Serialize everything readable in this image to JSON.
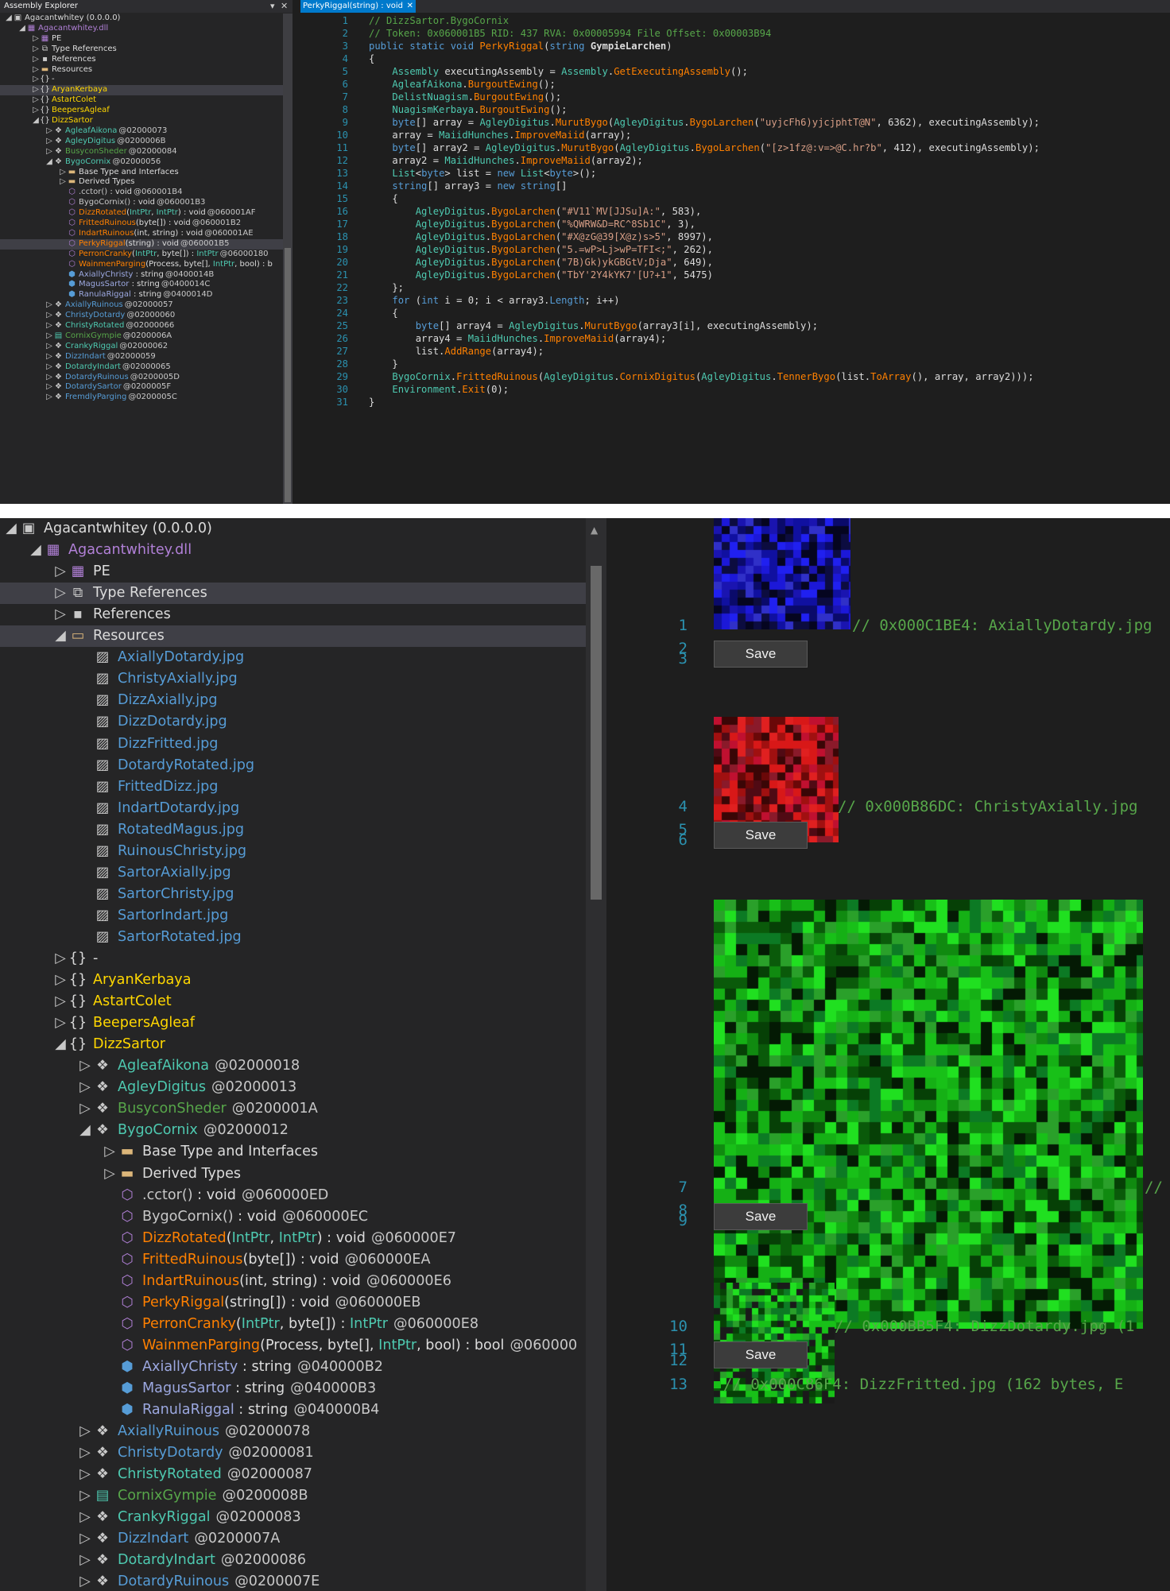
{
  "top": {
    "explorer": {
      "title": "Assembly Explorer",
      "items": [
        {
          "label": "Agacantwhitey (0.0.0.0)",
          "expand": "◢",
          "icon": "assembly-icon"
        },
        {
          "label": "Agacantwhitey.dll",
          "expand": "◢",
          "icon": "module-icon"
        },
        {
          "label": "PE",
          "expand": "▷",
          "icon": "pe-icon"
        },
        {
          "label": "Type References",
          "expand": "▷",
          "icon": "type-references-icon"
        },
        {
          "label": "References",
          "expand": "▷",
          "icon": "references-icon"
        },
        {
          "label": "Resources",
          "expand": "▷",
          "icon": "folder-icon"
        },
        {
          "label": "-",
          "expand": "▷",
          "icon": "namespace-icon"
        },
        {
          "label": "AryanKerbaya",
          "expand": "▷",
          "icon": "namespace-icon"
        },
        {
          "label": "AstartColet",
          "expand": "▷",
          "icon": "namespace-icon"
        },
        {
          "label": "BeepersAgleaf",
          "expand": "▷",
          "icon": "namespace-icon"
        },
        {
          "label": "DizzSartor",
          "expand": "◢",
          "icon": "namespace-icon"
        },
        {
          "label": "AgleafAikona",
          "token": "@02000073",
          "expand": "▷",
          "icon": "class-icon"
        },
        {
          "label": "AgleyDigitus",
          "token": "@0200006B",
          "expand": "▷",
          "icon": "class-icon"
        },
        {
          "label": "BusyconSheder",
          "token": "@02000084",
          "expand": "▷",
          "icon": "class-icon"
        },
        {
          "label": "BygoCornix",
          "token": "@02000056",
          "expand": "◢",
          "icon": "class-icon"
        },
        {
          "label": "Base Type and Interfaces",
          "expand": "▷",
          "icon": "folder-icon"
        },
        {
          "label": "Derived Types",
          "expand": "▷",
          "icon": "folder-icon"
        },
        {
          "label": ".cctor()",
          "sig": " : void",
          "token": "@060001B4",
          "icon": "method-icon"
        },
        {
          "label": "BygoCornix()",
          "sig": " : void",
          "token": "@060001B3",
          "icon": "method-icon"
        },
        {
          "label": "DizzRotated",
          "p1": "(",
          "a1": "IntPtr",
          "p2": ", ",
          "a2": "IntPtr",
          "p3": ") : void",
          "token": "@060001AF",
          "icon": "method-icon"
        },
        {
          "label": "FrittedRuinous",
          "p1": "(byte[]) : void",
          "token": "@060001B2",
          "icon": "method-icon"
        },
        {
          "label": "IndartRuinous",
          "p1": "(int, string) : void",
          "token": "@060001AE",
          "icon": "method-icon"
        },
        {
          "label": "PerkyRiggal",
          "p1": "(string) : void",
          "token": "@060001B5",
          "icon": "method-icon"
        },
        {
          "label": "PerronCranky",
          "p1": "(",
          "a1": "IntPtr",
          "p2": ", byte[]) : ",
          "a2": "IntPtr",
          "token": "@06000180",
          "icon": "method-icon"
        },
        {
          "label": "WainmenParging",
          "p1": "(Process, byte[], ",
          "a1": "IntPtr",
          "p2": ", bool) : b",
          "icon": "method-icon"
        },
        {
          "label": "AxiallyChristy",
          "sig": " : string",
          "token": "@0400014B",
          "icon": "field-icon"
        },
        {
          "label": "MagusSartor",
          "sig": " : string",
          "token": "@0400014C",
          "icon": "field-icon"
        },
        {
          "label": "RanulaRiggal",
          "sig": " : string",
          "token": "@0400014D",
          "icon": "field-icon"
        },
        {
          "label": "AxiallyRuinous",
          "token": "@02000057",
          "expand": "▷",
          "icon": "class-icon"
        },
        {
          "label": "ChristyDotardy",
          "token": "@02000060",
          "expand": "▷",
          "icon": "class-icon"
        },
        {
          "label": "ChristyRotated",
          "token": "@02000066",
          "expand": "▷",
          "icon": "class-icon"
        },
        {
          "label": "CornixGympie",
          "token": "@0200006A",
          "expand": "▷",
          "icon": "struct-icon"
        },
        {
          "label": "CrankyRiggal",
          "token": "@02000062",
          "expand": "▷",
          "icon": "class-icon"
        },
        {
          "label": "DizzIndart",
          "token": "@02000059",
          "expand": "▷",
          "icon": "class-icon"
        },
        {
          "label": "DotardyIndart",
          "token": "@02000065",
          "expand": "▷",
          "icon": "class-icon"
        },
        {
          "label": "DotardyRuinous",
          "token": "@0200005D",
          "expand": "▷",
          "icon": "class-icon"
        },
        {
          "label": "DotardySartor",
          "token": "@0200005F",
          "expand": "▷",
          "icon": "class-icon"
        },
        {
          "label": "FremdlyParging",
          "token": "@0200005C",
          "expand": "▷",
          "icon": "class-icon"
        }
      ]
    },
    "tab_label": "PerkyRiggal(string) : void",
    "code_line_numbers": [
      "1",
      "2",
      "3",
      "4",
      "5",
      "6",
      "7",
      "8",
      "9",
      "10",
      "11",
      "12",
      "13",
      "14",
      "15",
      "16",
      "17",
      "18",
      "19",
      "20",
      "21",
      "22",
      "23",
      "24",
      "25",
      "26",
      "27",
      "28",
      "29",
      "30",
      "31"
    ]
  },
  "bottom": {
    "tree": {
      "items": [
        {
          "label": "Agacantwhitey (0.0.0.0)",
          "expand": "◢",
          "icon": "assembly-icon"
        },
        {
          "label": "Agacantwhitey.dll",
          "expand": "◢",
          "icon": "module-icon"
        },
        {
          "label": "PE",
          "expand": "▷",
          "icon": "pe-icon"
        },
        {
          "label": "Type References",
          "expand": "▷",
          "icon": "type-references-icon"
        },
        {
          "label": "References",
          "expand": "▷",
          "icon": "references-icon"
        },
        {
          "label": "Resources",
          "expand": "◢",
          "icon": "folder-open-icon"
        },
        {
          "label": "AxiallyDotardy.jpg",
          "icon": "image-file-icon"
        },
        {
          "label": "ChristyAxially.jpg",
          "icon": "image-file-icon"
        },
        {
          "label": "DizzAxially.jpg",
          "icon": "image-file-icon"
        },
        {
          "label": "DizzDotardy.jpg",
          "icon": "image-file-icon"
        },
        {
          "label": "DizzFritted.jpg",
          "icon": "image-file-icon"
        },
        {
          "label": "DotardyRotated.jpg",
          "icon": "image-file-icon"
        },
        {
          "label": "FrittedDizz.jpg",
          "icon": "image-file-icon"
        },
        {
          "label": "IndartDotardy.jpg",
          "icon": "image-file-icon"
        },
        {
          "label": "RotatedMagus.jpg",
          "icon": "image-file-icon"
        },
        {
          "label": "RuinousChristy.jpg",
          "icon": "image-file-icon"
        },
        {
          "label": "SartorAxially.jpg",
          "icon": "image-file-icon"
        },
        {
          "label": "SartorChristy.jpg",
          "icon": "image-file-icon"
        },
        {
          "label": "SartorIndart.jpg",
          "icon": "image-file-icon"
        },
        {
          "label": "SartorRotated.jpg",
          "icon": "image-file-icon"
        },
        {
          "label": "-",
          "expand": "▷",
          "icon": "namespace-icon"
        },
        {
          "label": "AryanKerbaya",
          "expand": "▷",
          "icon": "namespace-icon"
        },
        {
          "label": "AstartColet",
          "expand": "▷",
          "icon": "namespace-icon"
        },
        {
          "label": "BeepersAgleaf",
          "expand": "▷",
          "icon": "namespace-icon"
        },
        {
          "label": "DizzSartor",
          "expand": "◢",
          "icon": "namespace-icon"
        },
        {
          "label": "AgleafAikona",
          "token": "@02000018",
          "expand": "▷",
          "icon": "class-icon"
        },
        {
          "label": "AgleyDigitus",
          "token": "@02000013",
          "expand": "▷",
          "icon": "class-icon"
        },
        {
          "label": "BusyconSheder",
          "token": "@0200001A",
          "expand": "▷",
          "icon": "class-icon"
        },
        {
          "label": "BygoCornix",
          "token": "@02000012",
          "expand": "◢",
          "icon": "class-icon"
        },
        {
          "label": "Base Type and Interfaces",
          "expand": "▷",
          "icon": "folder-icon"
        },
        {
          "label": "Derived Types",
          "expand": "▷",
          "icon": "folder-icon"
        },
        {
          "label": ".cctor()",
          "sig": " : void",
          "token": "@060000ED",
          "icon": "method-icon"
        },
        {
          "label": "BygoCornix()",
          "sig": " : void",
          "token": "@060000EC",
          "icon": "method-icon"
        },
        {
          "label": "DizzRotated",
          "p1": "(",
          "a1": "IntPtr",
          "p2": ", ",
          "a2": "IntPtr",
          "p3": ") : void",
          "token": "@060000E7",
          "icon": "method-icon"
        },
        {
          "label": "FrittedRuinous",
          "p1": "(byte[]) : void",
          "token": "@060000EA",
          "icon": "method-icon"
        },
        {
          "label": "IndartRuinous",
          "p1": "(int, string) : void",
          "token": "@060000E6",
          "icon": "method-icon"
        },
        {
          "label": "PerkyRiggal",
          "p1": "(string[]) : void",
          "token": "@060000EB",
          "icon": "method-icon"
        },
        {
          "label": "PerronCranky",
          "p1": "(",
          "a1": "IntPtr",
          "p2": ", byte[]) : ",
          "a2": "IntPtr",
          "token": "@060000E8",
          "icon": "method-icon"
        },
        {
          "label": "WainmenParging",
          "p1": "(Process, byte[], ",
          "a1": "IntPtr",
          "p2": ", bool) : bool",
          "token": "@060000",
          "icon": "method-icon"
        },
        {
          "label": "AxiallyChristy",
          "sig": " : string",
          "token": "@040000B2",
          "icon": "field-icon"
        },
        {
          "label": "MagusSartor",
          "sig": " : string",
          "token": "@040000B3",
          "icon": "field-icon"
        },
        {
          "label": "RanulaRiggal",
          "sig": " : string",
          "token": "@040000B4",
          "icon": "field-icon"
        },
        {
          "label": "AxiallyRuinous",
          "token": "@02000078",
          "expand": "▷",
          "icon": "class-icon"
        },
        {
          "label": "ChristyDotardy",
          "token": "@02000081",
          "expand": "▷",
          "icon": "class-icon"
        },
        {
          "label": "ChristyRotated",
          "token": "@02000087",
          "expand": "▷",
          "icon": "class-icon"
        },
        {
          "label": "CornixGympie",
          "token": "@0200008B",
          "expand": "▷",
          "icon": "struct-icon"
        },
        {
          "label": "CrankyRiggal",
          "token": "@02000083",
          "expand": "▷",
          "icon": "class-icon"
        },
        {
          "label": "DizzIndart",
          "token": "@0200007A",
          "expand": "▷",
          "icon": "class-icon"
        },
        {
          "label": "DotardyIndart",
          "token": "@02000086",
          "expand": "▷",
          "icon": "class-icon"
        },
        {
          "label": "DotardyRuinous",
          "token": "@0200007E",
          "expand": "▷",
          "icon": "class-icon"
        }
      ]
    },
    "resource_view": {
      "line_numbers": [
        "1",
        "2",
        "3",
        "4",
        "5",
        "6",
        "7",
        "8",
        "9",
        "10",
        "11",
        "12",
        "13"
      ],
      "save_label": "Save",
      "comments": [
        "// 0x000C1BE4: AxiallyDotardy.jpg",
        "// 0x000B86DC: ChristyAxially.jpg",
        "//",
        "// 0x000BB5F4: DizzDotardy.jpg (1",
        "// 0x000C86F4: DizzFritted.jpg (162 bytes, E"
      ],
      "image_names": [
        "AxiallyDotardy.jpg",
        "ChristyAxially.jpg",
        "DizzAxially.jpg",
        "DizzDotardy.jpg",
        "DizzFritted.jpg"
      ]
    }
  },
  "colors": {
    "background": "#1e1e1e",
    "panel": "#252526",
    "accent": "#007acc",
    "comment": "#57a64a",
    "keyword": "#569cd6",
    "type": "#4ec9b0",
    "string": "#d69d85",
    "method": "#ff8000",
    "line_number": "#2b91af",
    "namespace": "#ffd700",
    "module": "#b180d7",
    "resource": "#569cd6"
  }
}
